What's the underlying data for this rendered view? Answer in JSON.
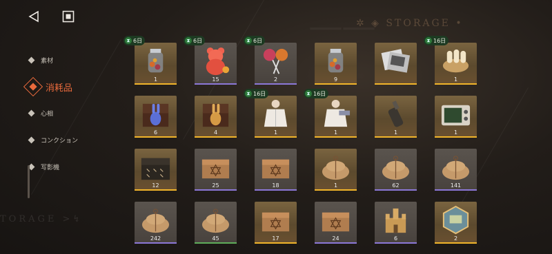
{
  "header": {
    "watermark": "STORAGE"
  },
  "side_watermark": "TORAGE",
  "sidebar": {
    "items": [
      {
        "label": "素材",
        "active": false
      },
      {
        "label": "消耗品",
        "active": true
      },
      {
        "label": "心相",
        "active": false
      },
      {
        "label": "コンクション",
        "active": false
      },
      {
        "label": "写影機",
        "active": false
      }
    ]
  },
  "colors": {
    "accent": "#e96a3c",
    "rarity_gold": "#f2b52a",
    "rarity_purple": "#8c78d8",
    "rarity_green": "#5fae5a",
    "timer_badge": "#1d3a22"
  },
  "items": [
    {
      "name": "candy-jar-item",
      "qty": "1",
      "badge": "6日",
      "rarity": "gold",
      "icon": "candy-jar"
    },
    {
      "name": "gummy-bear-item",
      "qty": "15",
      "badge": "6日",
      "rarity": "purple",
      "icon": "gummy-bear"
    },
    {
      "name": "lollipops-item",
      "qty": "2",
      "badge": "6日",
      "rarity": "purple",
      "icon": "lollipops"
    },
    {
      "name": "candy-jar-item-2",
      "qty": "9",
      "badge": "",
      "rarity": "gold",
      "icon": "candy-jar"
    },
    {
      "name": "photo-cards-item",
      "qty": "",
      "badge": "",
      "rarity": "gold",
      "icon": "photo-cards"
    },
    {
      "name": "cookies-item",
      "qty": "1",
      "badge": "16日",
      "rarity": "gold",
      "icon": "cookies"
    },
    {
      "name": "blue-rabbit-box-item",
      "qty": "6",
      "badge": "",
      "rarity": "gold",
      "icon": "rabbit-box-blue"
    },
    {
      "name": "gold-rabbit-box-item",
      "qty": "4",
      "badge": "",
      "rarity": "gold",
      "icon": "rabbit-box-gold"
    },
    {
      "name": "doll-coat-item",
      "qty": "1",
      "badge": "16日",
      "rarity": "gold",
      "icon": "doll-coat"
    },
    {
      "name": "doll-coat-tag-item",
      "qty": "1",
      "badge": "16日",
      "rarity": "gold",
      "icon": "doll-coat-tag"
    },
    {
      "name": "bottle-item",
      "qty": "1",
      "badge": "",
      "rarity": "gold",
      "icon": "bottle"
    },
    {
      "name": "tv-set-item",
      "qty": "1",
      "badge": "",
      "rarity": "gold",
      "icon": "tv-set"
    },
    {
      "name": "dark-chest-item",
      "qty": "12",
      "badge": "",
      "rarity": "gold",
      "icon": "dark-chest"
    },
    {
      "name": "wooden-crate-item",
      "qty": "25",
      "badge": "",
      "rarity": "purple",
      "icon": "crate"
    },
    {
      "name": "wooden-crate-item-2",
      "qty": "18",
      "badge": "",
      "rarity": "purple",
      "icon": "crate"
    },
    {
      "name": "sack-item",
      "qty": "1",
      "badge": "",
      "rarity": "gold",
      "icon": "sack"
    },
    {
      "name": "sack-item-2",
      "qty": "62",
      "badge": "",
      "rarity": "purple",
      "icon": "sack"
    },
    {
      "name": "sack-item-3",
      "qty": "141",
      "badge": "",
      "rarity": "purple",
      "icon": "sack"
    },
    {
      "name": "sack-item-4",
      "qty": "242",
      "badge": "",
      "rarity": "purple",
      "icon": "sack"
    },
    {
      "name": "sack-item-5",
      "qty": "45",
      "badge": "",
      "rarity": "green",
      "icon": "sack"
    },
    {
      "name": "wooden-crate-item-3",
      "qty": "17",
      "badge": "",
      "rarity": "gold",
      "icon": "crate"
    },
    {
      "name": "wooden-crate-item-4",
      "qty": "24",
      "badge": "",
      "rarity": "purple",
      "icon": "crate"
    },
    {
      "name": "castle-item",
      "qty": "6",
      "badge": "",
      "rarity": "purple",
      "icon": "castle"
    },
    {
      "name": "map-badge-item",
      "qty": "2",
      "badge": "",
      "rarity": "gold",
      "icon": "map-badge"
    }
  ]
}
